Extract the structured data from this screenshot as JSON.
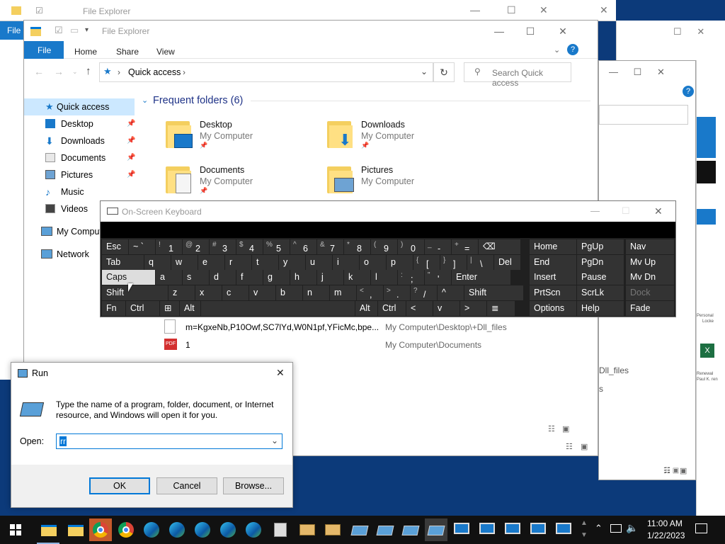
{
  "back_explorer": {
    "title": "File Explorer",
    "file_tab": "File"
  },
  "explorer": {
    "title": "File Explorer",
    "ribbon": {
      "file": "File",
      "home": "Home",
      "share": "Share",
      "view": "View"
    },
    "address": {
      "location": "Quick access",
      "separator": ">"
    },
    "search": {
      "placeholder": "Search Quick access"
    },
    "nav": [
      {
        "label": "Quick access",
        "icon": "star-icon",
        "pinned": false
      },
      {
        "label": "Desktop",
        "icon": "desktop-icon",
        "pinned": true
      },
      {
        "label": "Downloads",
        "icon": "downloads-icon",
        "pinned": true
      },
      {
        "label": "Documents",
        "icon": "documents-icon",
        "pinned": true
      },
      {
        "label": "Pictures",
        "icon": "pictures-icon",
        "pinned": true
      },
      {
        "label": "Music",
        "icon": "music-icon",
        "pinned": false
      },
      {
        "label": "Videos",
        "icon": "videos-icon",
        "pinned": false
      },
      {
        "label": "My Comput",
        "icon": "computer-icon",
        "pinned": false
      },
      {
        "label": "Network",
        "icon": "network-icon",
        "pinned": false
      }
    ],
    "section_title": "Frequent folders (6)",
    "folders": [
      {
        "name": "Desktop",
        "location": "My Computer"
      },
      {
        "name": "Downloads",
        "location": "My Computer"
      },
      {
        "name": "Documents",
        "location": "My Computer"
      },
      {
        "name": "Pictures",
        "location": "My Computer"
      }
    ],
    "recent_files": [
      {
        "name": "m=KgxeNb,P10Owf,SC7lYd,W0N1pf,YFicMc,bpe...",
        "path": "My Computer\\Desktop\\+Dll_files"
      },
      {
        "name": "1",
        "path": "My Computer\\Documents"
      }
    ]
  },
  "right_window": {
    "partial_text_1": "Dll_files",
    "partial_text_2": "s",
    "partial_text_3": "ss",
    "side_text_1": "Personal",
    "side_text_2": "Locke",
    "side_text_3": "Renewal",
    "side_text_4": "Paul K. ren"
  },
  "osk": {
    "title": "On-Screen Keyboard",
    "row1": [
      {
        "main": "Esc",
        "shift": ""
      },
      {
        "main": "~ `",
        "shift": ""
      },
      {
        "main": "1",
        "shift": "!"
      },
      {
        "main": "2",
        "shift": "@"
      },
      {
        "main": "3",
        "shift": "#"
      },
      {
        "main": "4",
        "shift": "$"
      },
      {
        "main": "5",
        "shift": "%"
      },
      {
        "main": "6",
        "shift": "^"
      },
      {
        "main": "7",
        "shift": "&"
      },
      {
        "main": "8",
        "shift": "*"
      },
      {
        "main": "9",
        "shift": "("
      },
      {
        "main": "0",
        "shift": ")"
      },
      {
        "main": "-",
        "shift": "_"
      },
      {
        "main": "=",
        "shift": "+"
      },
      {
        "main": "⌫",
        "shift": ""
      }
    ],
    "row2": [
      "Tab",
      "q",
      "w",
      "e",
      "r",
      "t",
      "y",
      "u",
      "i",
      "o",
      "p",
      "[",
      "]",
      "\\",
      "Del"
    ],
    "row2_shift": [
      "",
      "",
      "",
      "",
      "",
      "",
      "",
      "",
      "",
      "",
      "",
      "{",
      "}",
      "|",
      ""
    ],
    "row3": [
      "Caps",
      "a",
      "s",
      "d",
      "f",
      "g",
      "h",
      "j",
      "k",
      "l",
      ";",
      "'",
      "Enter"
    ],
    "row3_shift": [
      "",
      "",
      "",
      "",
      "",
      "",
      "",
      "",
      "",
      "",
      ":",
      "\"",
      ""
    ],
    "row4": [
      "Shift",
      "z",
      "x",
      "c",
      "v",
      "b",
      "n",
      "m",
      ",",
      ".",
      "/",
      "^",
      "Shift"
    ],
    "row4_shift": [
      "",
      "",
      "",
      "",
      "",
      "",
      "",
      "",
      "<",
      ">",
      "?",
      "",
      ""
    ],
    "row5": [
      "Fn",
      "Ctrl",
      "⊞",
      "Alt",
      "",
      "Alt",
      "Ctrl",
      "<",
      "v",
      ">",
      "≣"
    ],
    "nav_keys": [
      [
        "Home",
        "PgUp",
        "Nav"
      ],
      [
        "End",
        "PgDn",
        "Mv Up"
      ],
      [
        "Insert",
        "Pause",
        "Mv Dn"
      ],
      [
        "PrtScn",
        "ScrLk",
        "Dock"
      ],
      [
        "Options",
        "Help",
        "Fade"
      ]
    ]
  },
  "run": {
    "title": "Run",
    "description": "Type the name of a program, folder, document, or Internet resource, and Windows will open it for you.",
    "open_label": "Open:",
    "open_value": "rr",
    "ok": "OK",
    "cancel": "Cancel",
    "browse": "Browse..."
  },
  "taskbar": {
    "time": "11:00 AM",
    "date": "1/22/2023"
  },
  "colors": {
    "accent": "#1979ca",
    "osk_bg": "#202020",
    "taskbar": "#111111"
  }
}
